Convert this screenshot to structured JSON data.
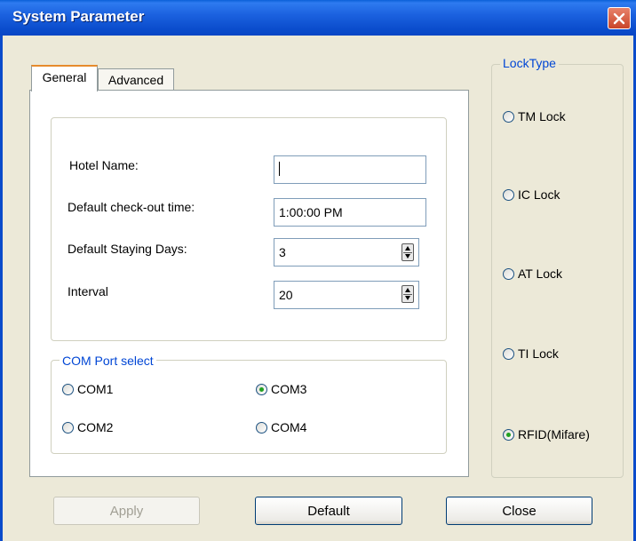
{
  "window": {
    "title": "System Parameter"
  },
  "tabs": [
    {
      "label": "General",
      "active": true
    },
    {
      "label": "Advanced",
      "active": false
    }
  ],
  "general": {
    "hotel_name": {
      "label": "Hotel Name:",
      "value": ""
    },
    "checkout_time": {
      "label": "Default check-out time:",
      "value": "1:00:00 PM"
    },
    "staying_days": {
      "label": "Default Staying Days:",
      "value": "3"
    },
    "interval": {
      "label": "Interval",
      "value": "20"
    }
  },
  "com_port": {
    "legend": "COM Port select",
    "options": [
      {
        "label": "COM1",
        "checked": false
      },
      {
        "label": "COM3",
        "checked": true
      },
      {
        "label": "COM2",
        "checked": false
      },
      {
        "label": "COM4",
        "checked": false
      }
    ]
  },
  "lock_type": {
    "legend": "LockType",
    "options": [
      {
        "label": "TM Lock",
        "checked": false
      },
      {
        "label": "IC Lock",
        "checked": false
      },
      {
        "label": "AT Lock",
        "checked": false
      },
      {
        "label": "TI Lock",
        "checked": false
      },
      {
        "label": "RFID(Mifare)",
        "checked": true
      }
    ]
  },
  "buttons": {
    "apply": {
      "label": "Apply",
      "enabled": false
    },
    "default": {
      "label": "Default"
    },
    "close": {
      "label": "Close"
    }
  },
  "colors": {
    "title_bar": "#0A4BCB",
    "accent_legend": "#0046D5",
    "radio_dot": "#21A121",
    "dialog_bg": "#ECE9D8"
  },
  "icons": {
    "close": "close-icon",
    "spin": "spin-arrows-icon"
  }
}
